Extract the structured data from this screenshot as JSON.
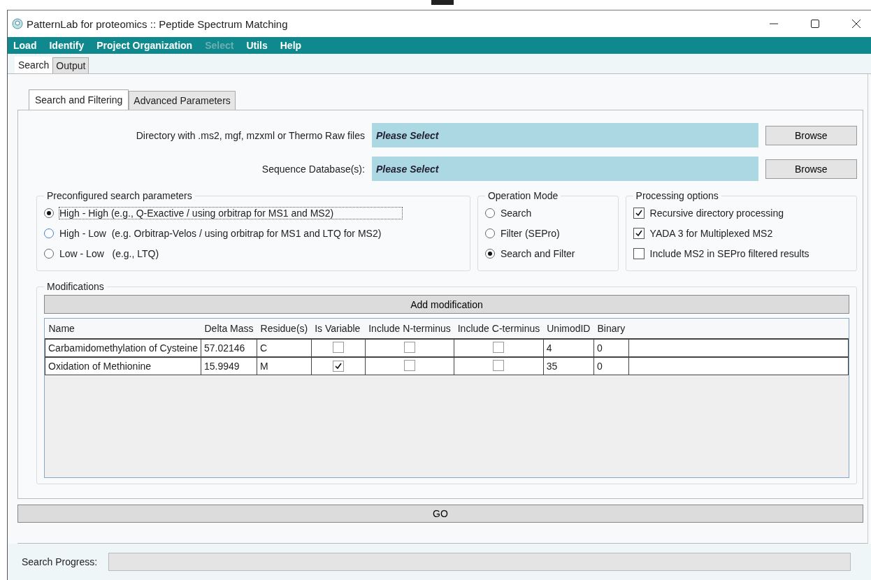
{
  "window": {
    "title": "PatternLab for proteomics :: Peptide Spectrum Matching"
  },
  "menu": [
    {
      "label": "Load",
      "disabled": false
    },
    {
      "label": "Identify",
      "disabled": false
    },
    {
      "label": "Project Organization",
      "disabled": false
    },
    {
      "label": "Select",
      "disabled": true
    },
    {
      "label": "Utils",
      "disabled": false
    },
    {
      "label": "Help",
      "disabled": false
    }
  ],
  "tabs": [
    {
      "label": "Search",
      "selected": true
    },
    {
      "label": "Output",
      "selected": false
    }
  ],
  "subtabs": [
    {
      "label": "Search and Filtering",
      "selected": true
    },
    {
      "label": "Advanced Parameters",
      "selected": false
    }
  ],
  "fields": [
    {
      "label": "Directory with .ms2, mgf, mzxml or Thermo Raw files",
      "value": "Please Select",
      "button": "Browse"
    },
    {
      "label": "Sequence Database(s):",
      "value": "Please Select",
      "button": "Browse"
    }
  ],
  "preconfigured": {
    "title": "Preconfigured search parameters",
    "options": [
      {
        "label": "High - High (e.g., Q-Exactive / using orbitrap for MS1 and MS2)",
        "selected": true
      },
      {
        "label": "High - Low  (e.g. Orbitrap-Velos / using orbitrap for MS1 and LTQ for MS2)",
        "selected": false
      },
      {
        "label": "Low - Low   (e.g., LTQ)",
        "selected": false
      }
    ]
  },
  "operation_mode": {
    "title": "Operation Mode",
    "options": [
      {
        "label": "Search",
        "selected": false
      },
      {
        "label": "Filter (SEPro)",
        "selected": false
      },
      {
        "label": "Search and Filter",
        "selected": true
      }
    ]
  },
  "processing_options": {
    "title": "Processing options",
    "options": [
      {
        "label": "Recursive directory processing",
        "checked": true
      },
      {
        "label": "YADA 3 for Multiplexed MS2",
        "checked": true
      },
      {
        "label": "Include MS2 in SEPro filtered results",
        "checked": false
      }
    ]
  },
  "modifications": {
    "title": "Modifications",
    "add_button": "Add modification",
    "columns": [
      "Name",
      "Delta Mass",
      "Residue(s)",
      "Is Variable",
      "Include N-terminus",
      "Include C-terminus",
      "UnimodID",
      "Binary"
    ],
    "rows": [
      {
        "name": "Carbamidomethylation of Cysteine",
        "delta_mass": "57.02146",
        "residues": "C",
        "is_variable": false,
        "include_n_terminus": false,
        "include_c_terminus": false,
        "unimod_id": "4",
        "binary": "0"
      },
      {
        "name": "Oxidation of Methionine",
        "delta_mass": "15.9949",
        "residues": "M",
        "is_variable": true,
        "include_n_terminus": false,
        "include_c_terminus": false,
        "unimod_id": "35",
        "binary": "0"
      }
    ]
  },
  "go_button": "GO",
  "status_bar": {
    "label": "Search Progress:",
    "level": 0
  }
}
